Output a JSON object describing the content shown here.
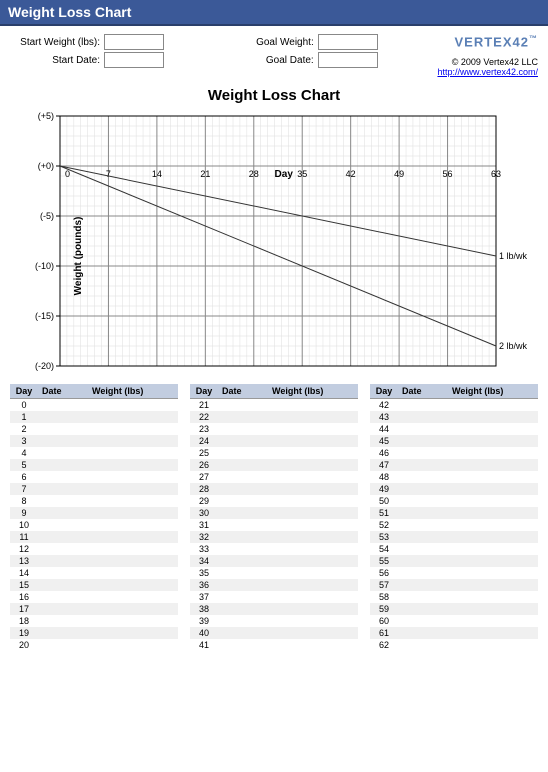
{
  "header": {
    "title": "Weight Loss Chart"
  },
  "branding": {
    "logo_text": "VERTEX",
    "logo_num": "42",
    "copyright": "© 2009 Vertex42 LLC",
    "link": "http://www.vertex42.com/"
  },
  "inputs": {
    "start_weight_label": "Start Weight (lbs):",
    "start_date_label": "Start Date:",
    "goal_weight_label": "Goal Weight:",
    "goal_date_label": "Goal Date:",
    "start_weight_value": "",
    "start_date_value": "",
    "goal_weight_value": "",
    "goal_date_value": ""
  },
  "chart_data": {
    "type": "line",
    "title": "Weight Loss Chart",
    "xlabel": "Day",
    "ylabel": "Weight (pounds)",
    "xlim": [
      0,
      63
    ],
    "ylim": [
      -20,
      5
    ],
    "xticks": [
      0,
      7,
      14,
      21,
      28,
      35,
      42,
      49,
      56,
      63
    ],
    "yticks": [
      -20,
      -15,
      -10,
      -5,
      0,
      5
    ],
    "ytick_labels": [
      "(-20)",
      "(-15)",
      "(-10)",
      "(-5)",
      "(+0)",
      "(+5)"
    ],
    "series": [
      {
        "name": "1 lb/wk",
        "x": [
          0,
          63
        ],
        "y": [
          0,
          -9
        ]
      },
      {
        "name": "2 lb/wk",
        "x": [
          0,
          63
        ],
        "y": [
          0,
          -18
        ]
      }
    ]
  },
  "tables": {
    "headers": {
      "day": "Day",
      "date": "Date",
      "weight": "Weight (lbs)"
    },
    "columns": [
      {
        "start": 0,
        "end": 20
      },
      {
        "start": 21,
        "end": 41
      },
      {
        "start": 42,
        "end": 62
      }
    ]
  }
}
